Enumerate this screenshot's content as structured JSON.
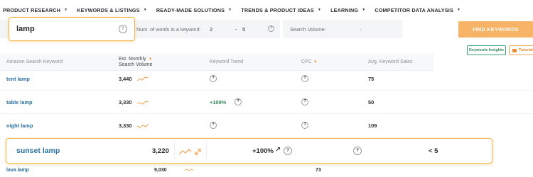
{
  "nav": {
    "items": [
      {
        "label": "PRODUCT RESEARCH"
      },
      {
        "label": "KEYWORDS & LISTINGS"
      },
      {
        "label": "READY-MADE SOLUTIONS"
      },
      {
        "label": "TRENDS & PRODUCT IDEAS"
      },
      {
        "label": "LEARNING"
      },
      {
        "label": "COMPETITOR DATA ANALYSIS"
      }
    ]
  },
  "search": {
    "keyword": "lamp",
    "words_label": "Num. of words in a keyword:",
    "words_min": "2",
    "words_dash": "-",
    "words_max": "5",
    "volume_label": "Search Volume:",
    "volume_dash": "-",
    "find_button": "FIND KEYWORDS",
    "help_glyph": "?"
  },
  "actions": {
    "insights": "Keywords Insights",
    "tutorial": "Tutorial"
  },
  "table": {
    "headers": {
      "keyword": "Amazon Search Keyword",
      "volume_line1": "Est. Monthly",
      "volume_line2": "Search Volume",
      "trend": "Keyword Trend",
      "cpc": "CPC",
      "sales": "Avg. Keyword Sales"
    },
    "rows": [
      {
        "keyword": "tent lamp",
        "volume": "3,440",
        "trend": "",
        "sales": "75"
      },
      {
        "keyword": "table lamp",
        "volume": "3,330",
        "trend": "+100%",
        "sales": "50"
      },
      {
        "keyword": "night lamp",
        "volume": "3,330",
        "trend": "",
        "sales": "109"
      }
    ],
    "highlight": {
      "keyword": "sunset lamp",
      "volume": "3,220",
      "trend": "+100%",
      "sales": "< 5"
    },
    "partial": {
      "keyword": "lava lamp",
      "volume": "9,030",
      "sales": "73"
    }
  },
  "colors": {
    "accent": "#f5b54c",
    "link": "#2a6f9e",
    "trend_up": "#2e8b57"
  }
}
